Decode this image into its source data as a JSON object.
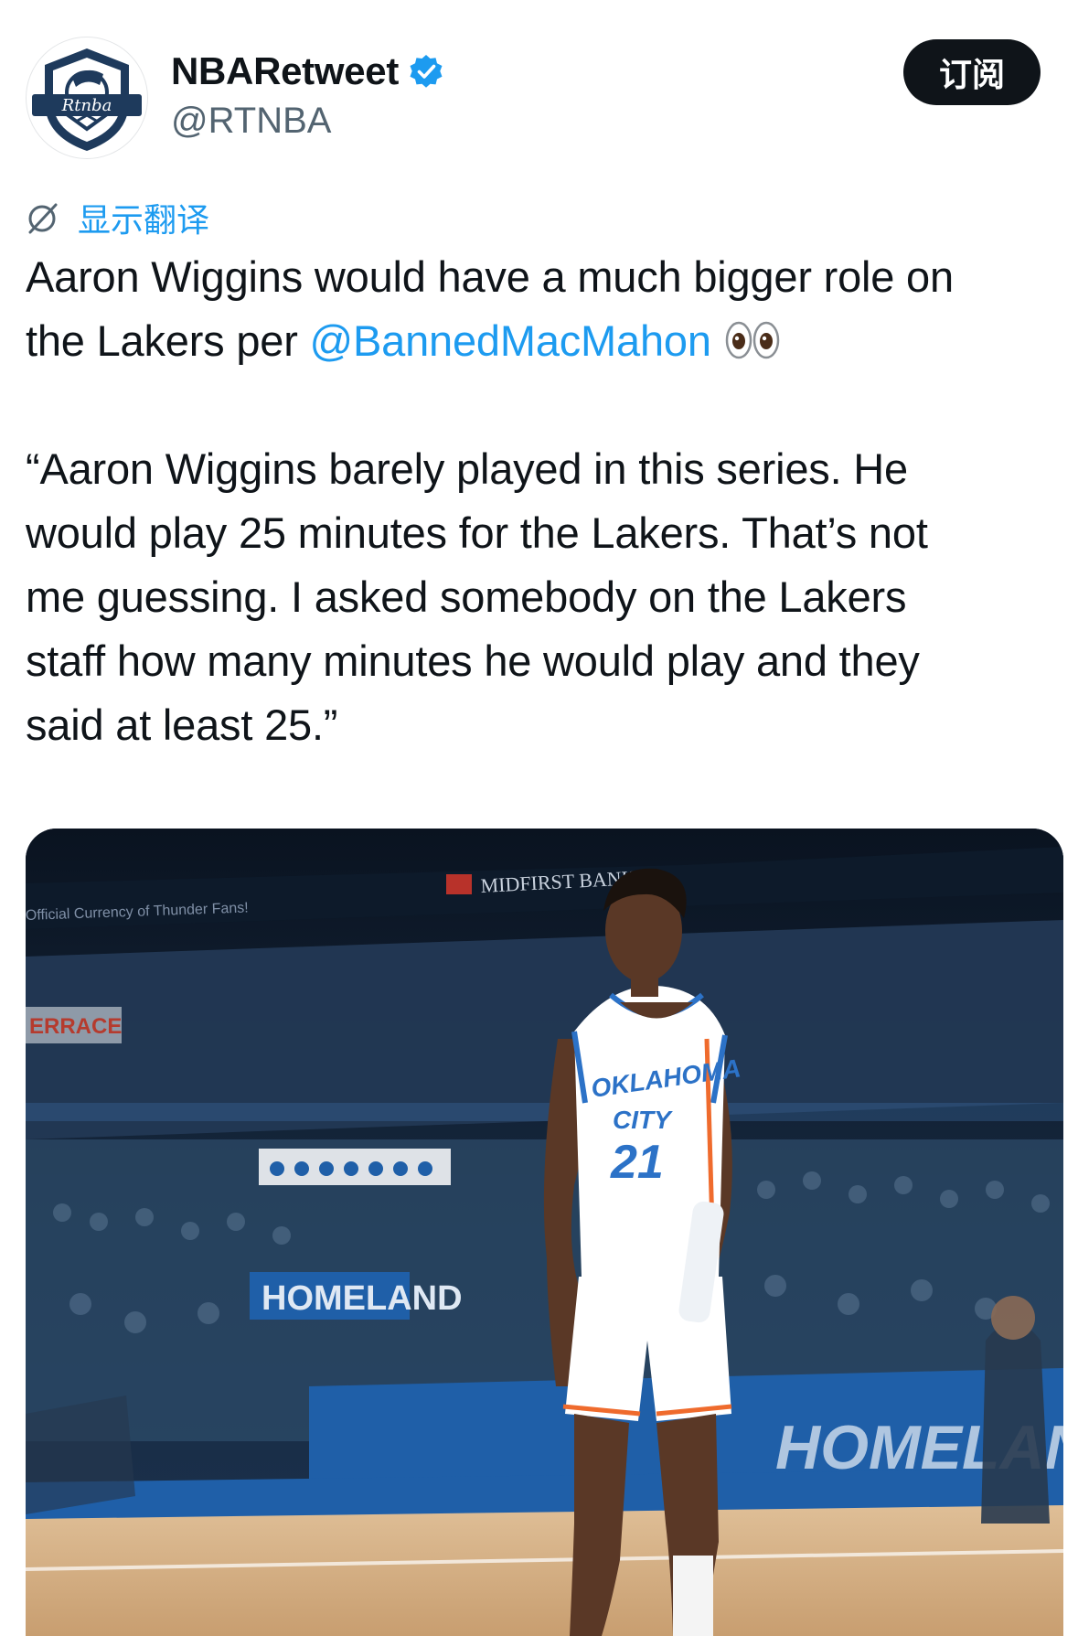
{
  "author": {
    "display_name": "NBARetweet",
    "handle": "@RTNBA",
    "verified": true,
    "avatar_logo_text": "Rtnba"
  },
  "actions": {
    "subscribe_label": "订阅"
  },
  "translate": {
    "label": "显示翻译"
  },
  "tweet": {
    "line1": "Aaron Wiggins would have a much bigger role on",
    "line2_prefix": "the Lakers per ",
    "mention": "@BannedMacMahon",
    "emoji": "eyes",
    "quote_lines": [
      "“Aaron Wiggins barely played in this series. He",
      "would play 25 minutes for the Lakers. That’s not",
      "me guessing. I asked somebody on the Lakers",
      "staff how many minutes he would play and they",
      "said at least 25.”"
    ]
  },
  "media": {
    "description": "photo",
    "signage": {
      "banner_left": "Official Currency of Thunder Fans!",
      "banner_top": "MIDFIRST BANK",
      "terrace": "ERRACE",
      "homeland": "HOMELAND",
      "court_sign": "HOMELAND"
    },
    "jersey": {
      "team_line1": "OKLAHOMA",
      "team_line2": "CITY",
      "number": "21"
    },
    "colors": {
      "court_blue": "#1f5fa8",
      "floor": "#d8b48a",
      "jersey_blue": "#2c72c7",
      "jersey_orange": "#ef6b2d"
    }
  },
  "colors": {
    "link": "#1d9bf0",
    "text": "#0f1419",
    "secondary": "#536471"
  }
}
